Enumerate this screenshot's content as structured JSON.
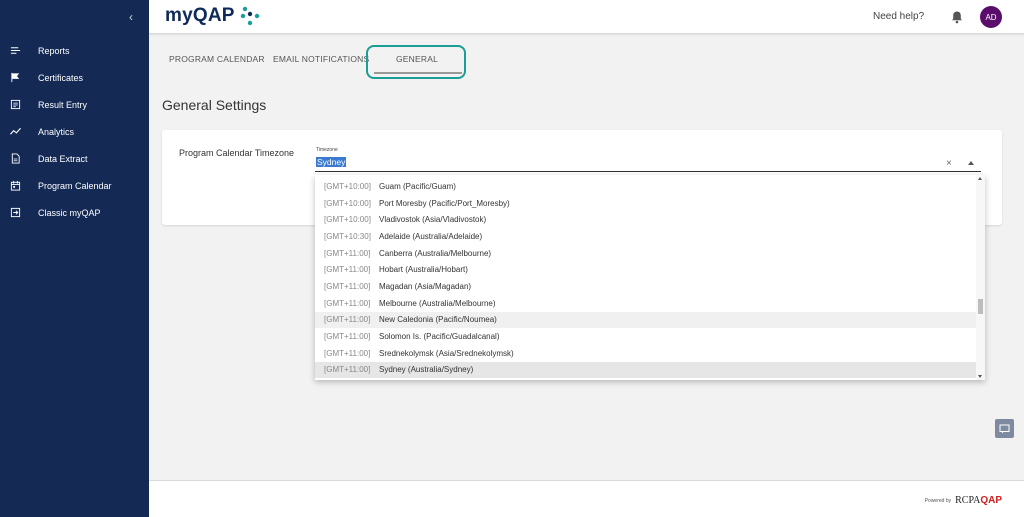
{
  "sidebar": {
    "collapse_icon": "chevron-left-icon",
    "collapse_glyph": "‹",
    "items": [
      {
        "label": "Reports",
        "icon": "menu-icon"
      },
      {
        "label": "Certificates",
        "icon": "flag-icon"
      },
      {
        "label": "Result Entry",
        "icon": "list-icon"
      },
      {
        "label": "Analytics",
        "icon": "trend-icon"
      },
      {
        "label": "Data Extract",
        "icon": "document-icon"
      },
      {
        "label": "Program Calendar",
        "icon": "calendar-icon"
      },
      {
        "label": "Classic myQAP",
        "icon": "exit-icon"
      }
    ]
  },
  "header": {
    "logo": "myQAP",
    "need_help": "Need help?",
    "avatar": "AD"
  },
  "tabs": [
    {
      "label": "PROGRAM CALENDAR"
    },
    {
      "label": "EMAIL NOTIFICATIONS"
    },
    {
      "label": "GENERAL"
    }
  ],
  "page": {
    "title": "General Settings",
    "setting_label": "Program Calendar Timezone",
    "timezone_field_label": "Timezone",
    "timezone_value": "Sydney",
    "clear_glyph": "×"
  },
  "timezones": [
    {
      "offset": "[GMT+10:00]",
      "name": "Guam (Pacific/Guam)"
    },
    {
      "offset": "[GMT+10:00]",
      "name": "Port Moresby (Pacific/Port_Moresby)"
    },
    {
      "offset": "[GMT+10:00]",
      "name": "Vladivostok (Asia/Vladivostok)"
    },
    {
      "offset": "[GMT+10:30]",
      "name": "Adelaide (Australia/Adelaide)"
    },
    {
      "offset": "[GMT+11:00]",
      "name": "Canberra (Australia/Melbourne)"
    },
    {
      "offset": "[GMT+11:00]",
      "name": "Hobart (Australia/Hobart)"
    },
    {
      "offset": "[GMT+11:00]",
      "name": "Magadan (Asia/Magadan)"
    },
    {
      "offset": "[GMT+11:00]",
      "name": "Melbourne (Australia/Melbourne)"
    },
    {
      "offset": "[GMT+11:00]",
      "name": "New Caledonia (Pacific/Noumea)"
    },
    {
      "offset": "[GMT+11:00]",
      "name": "Solomon Is. (Pacific/Guadalcanal)"
    },
    {
      "offset": "[GMT+11:00]",
      "name": "Srednekolymsk (Asia/Srednekolymsk)"
    },
    {
      "offset": "[GMT+11:00]",
      "name": "Sydney (Australia/Sydney)"
    }
  ],
  "footer": {
    "powered_by": "Powered by",
    "brand_prefix": "RCPA",
    "brand_suffix": "QAP"
  },
  "colors": {
    "sidebar": "#142a55",
    "accent_ring": "#1a9e96",
    "avatar": "#5b0d6b",
    "selection": "#3a7ad0"
  }
}
